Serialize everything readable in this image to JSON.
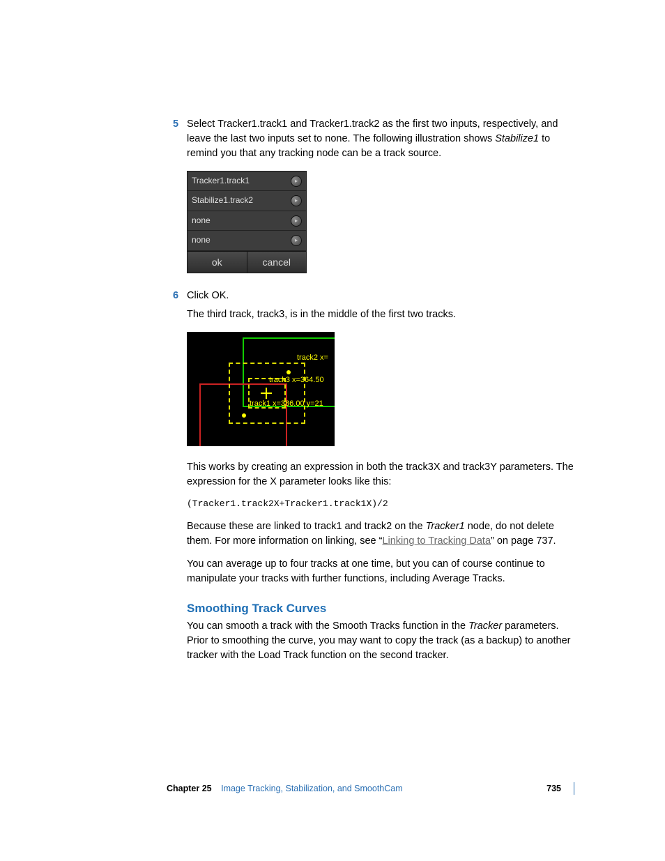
{
  "step5": {
    "num": "5",
    "para": "Select Tracker1.track1 and Tracker1.track2 as the first two inputs, respectively, and leave the last two inputs set to none. The following illustration shows ",
    "italic": "Stabilize1",
    "para_end": " to remind you that any tracking node can be a track source."
  },
  "panel": {
    "rows": [
      "Tracker1.track1",
      "Stabilize1.track2",
      "none",
      "none"
    ],
    "ok": "ok",
    "cancel": "cancel"
  },
  "step6": {
    "num": "6",
    "line1": "Click OK.",
    "line2": "The third track, track3, is in the middle of the first two tracks."
  },
  "viewport": {
    "label_track2": "track2 x=",
    "label_track3": "track3 x=364.50",
    "label_track1": "track1 x=386.00 y=21"
  },
  "body1": "This works by creating an expression in both the track3X and track3Y parameters. The expression for the X parameter looks like this:",
  "code": "(Tracker1.track2X+Tracker1.track1X)/2",
  "body2a": "Because these are linked to track1 and track2 on the ",
  "body2i": "Tracker1",
  "body2b": " node, do not delete them. For more information on linking, see “",
  "body2link": "Linking to Tracking Data",
  "body2c": "” on page 737.",
  "body3": "You can average up to four tracks at one time, but you can of course continue to manipulate your tracks with further functions, including Average Tracks.",
  "subhead": "Smoothing Track Curves",
  "body4a": "You can smooth a track with the Smooth Tracks function in the ",
  "body4i": "Tracker",
  "body4b": " parameters. Prior to smoothing the curve, you may want to copy the track (as a backup) to another tracker with the Load Track function on the second tracker.",
  "footer": {
    "chapter_label": "Chapter 25",
    "chapter_title": "Image Tracking, Stabilization, and SmoothCam",
    "page": "735"
  }
}
